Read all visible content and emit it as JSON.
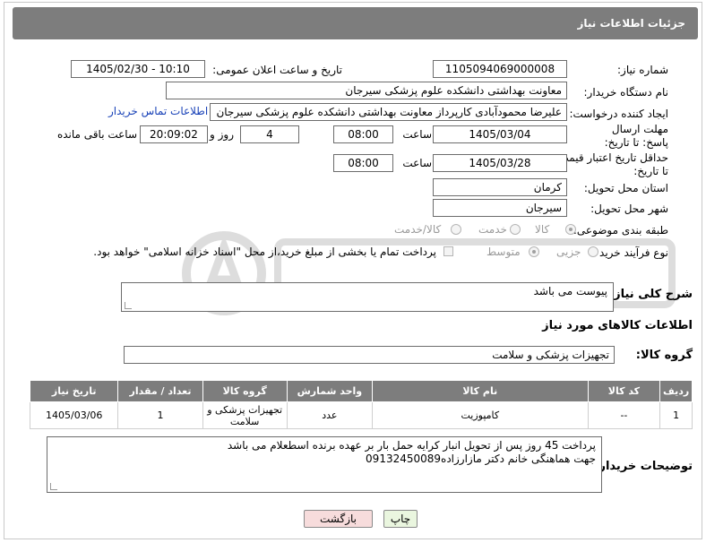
{
  "header": {
    "title": "جزئیات اطلاعات نیاز"
  },
  "form": {
    "need_number": {
      "label": "شماره نیاز:",
      "value": "1105094069000008"
    },
    "announce_datetime": {
      "label": "تاریخ و ساعت اعلان عمومی:",
      "value": "1405/02/30 - 10:10"
    },
    "buyer_org": {
      "label": "نام دستگاه خریدار:",
      "value": "معاونت بهداشتی دانشکده علوم پزشکی سیرجان"
    },
    "requester": {
      "label": "ایجاد کننده درخواست:",
      "value": "علیرضا  محمودآبادی کارپرداز معاونت بهداشتی دانشکده علوم پزشکی سیرجان",
      "contact_link": "اطلاعات تماس خریدار"
    },
    "reply_deadline": {
      "label": "مهلت ارسال پاسخ: تا تاریخ:",
      "date": "1405/03/04",
      "time_label": "ساعت",
      "time": "08:00",
      "days": "4",
      "days_label": "روز و",
      "remaining": "20:09:02",
      "remaining_label": "ساعت باقی مانده"
    },
    "price_validity": {
      "label": "حداقل تاریخ اعتبار قیمت: تا تاریخ:",
      "date": "1405/03/28",
      "time_label": "ساعت",
      "time": "08:00"
    },
    "province": {
      "label": "استان محل تحویل:",
      "value": "کرمان"
    },
    "city": {
      "label": "شهر محل تحویل:",
      "value": "سیرجان"
    },
    "category": {
      "label": "طبقه بندی موضوعی:",
      "options": [
        "کالا",
        "خدمت",
        "کالا/خدمت"
      ]
    },
    "process": {
      "label": "نوع فرآیند خرید :",
      "options": [
        "جزیی",
        "متوسط"
      ],
      "note": "پرداخت تمام یا بخشی از مبلغ خرید،از محل \"اسناد خزانه اسلامی\" خواهد بود."
    },
    "description": {
      "label": "شرح کلی نیاز:",
      "value": "پیوست می باشد"
    }
  },
  "goods": {
    "section_title": "اطلاعات کالاهای مورد نیاز",
    "group_label": "گروه کالا:",
    "group_value": "تجهیزات پزشکی و سلامت",
    "columns": [
      "ردیف",
      "کد کالا",
      "نام کالا",
      "واحد شمارش",
      "گروه کالا",
      "تعداد / مقدار",
      "تاریخ نیاز"
    ],
    "rows": [
      [
        "1",
        "--",
        "کامپوزیت",
        "عدد",
        "تجهیزات پزشکی و سلامت",
        "1",
        "1405/03/06"
      ]
    ]
  },
  "buyer_notes": {
    "label": "توضیحات خریدار:",
    "line1": "پرداخت 45 روز پس از تحویل انبار کرایه حمل بار بر عهده برنده اسطعلام می باشد",
    "line2": "جهت هماهنگی خانم دکتر مازارزاده09132450089"
  },
  "buttons": {
    "print": "چاپ",
    "back": "بازگشت"
  },
  "colors": {
    "header_bg": "#7d7d7d",
    "link": "#1a43b8",
    "back_btn_bg": "#f7dcdc",
    "print_btn_bg": "#eaf6df"
  }
}
